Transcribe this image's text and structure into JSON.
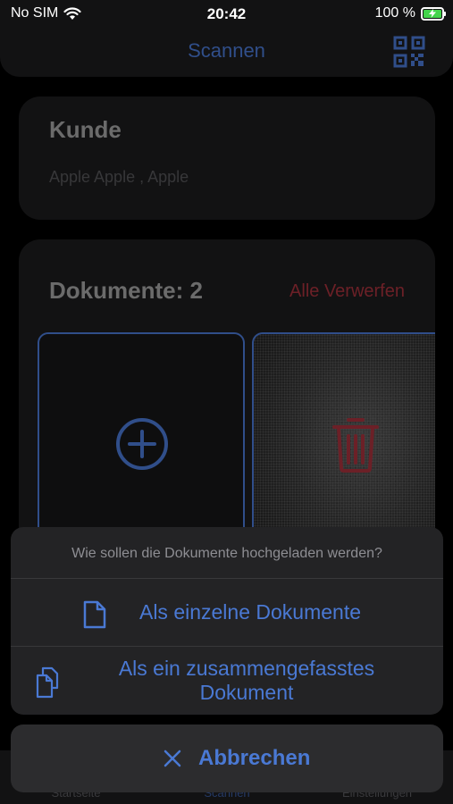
{
  "status_bar": {
    "carrier": "No SIM",
    "time": "20:42",
    "battery": "100 %"
  },
  "header": {
    "title": "Scannen",
    "qr_icon": "qr-code-icon"
  },
  "customer": {
    "title": "Kunde",
    "name": "Apple Apple , Apple"
  },
  "documents": {
    "title": "Dokumente: 2",
    "discard_all": "Alle Verwerfen"
  },
  "tabbar": {
    "items": [
      {
        "label": "Startseite"
      },
      {
        "label": "Scannen"
      },
      {
        "label": "Einstellungen"
      }
    ]
  },
  "action_sheet": {
    "message": "Wie sollen die Dokumente hochgeladen werden?",
    "option_single": "Als einzelne Dokumente",
    "option_merged": "Als ein zusammengefasstes Dokument",
    "cancel": "Abbrechen"
  },
  "colors": {
    "accent": "#4a79d4",
    "destructive": "#a7323c",
    "background": "#000000",
    "card": "#1c1c1e"
  }
}
